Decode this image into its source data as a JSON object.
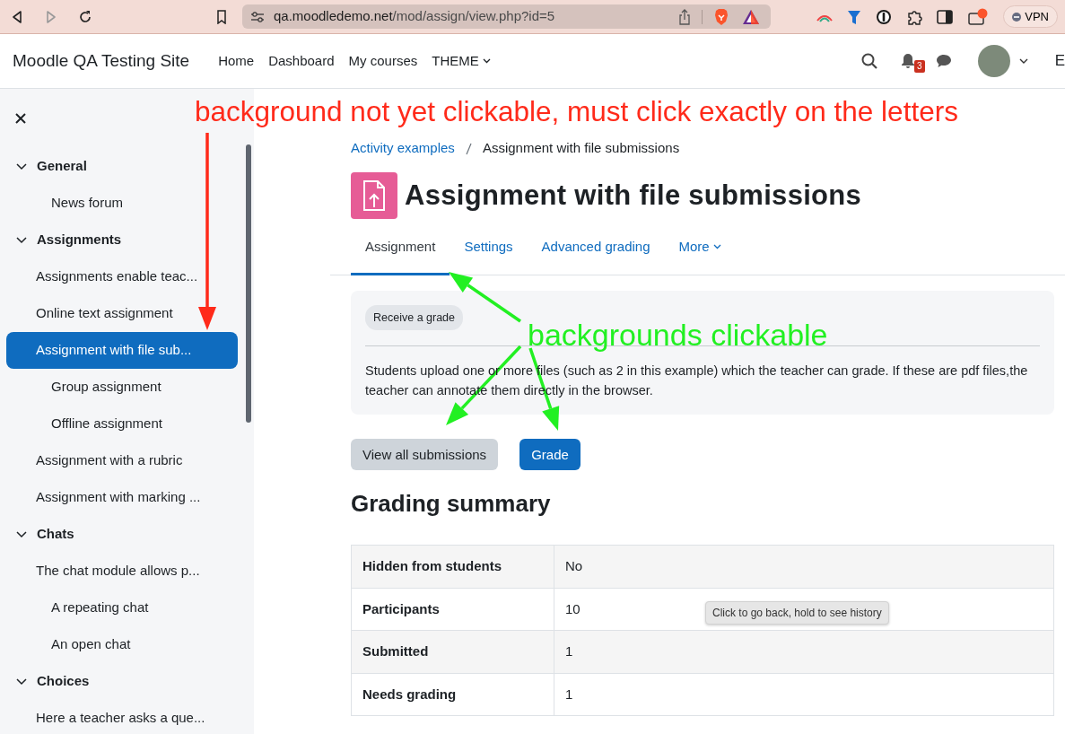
{
  "browser": {
    "url_host": "qa.moodledemo.net",
    "url_path": "/mod/assign/view.php?id=5",
    "vpn_label": "VPN"
  },
  "navbar": {
    "brand": "Moodle QA Testing Site",
    "links": [
      {
        "label": "Home",
        "dropdown": false
      },
      {
        "label": "Dashboard",
        "dropdown": false
      },
      {
        "label": "My courses",
        "dropdown": false
      },
      {
        "label": "THEME",
        "dropdown": true
      }
    ],
    "notification_count": "3",
    "user_menu_text": "E"
  },
  "sidebar": {
    "sections": [
      {
        "title": "General",
        "expanded": true,
        "items": [
          {
            "label": "News forum",
            "indented": true,
            "selected": false
          }
        ]
      },
      {
        "title": "Assignments",
        "expanded": true,
        "items": [
          {
            "label": "Assignments enable teac...",
            "indented": false,
            "selected": false
          },
          {
            "label": "Online text assignment",
            "indented": false,
            "selected": false
          },
          {
            "label": "Assignment with file sub...",
            "indented": false,
            "selected": true
          },
          {
            "label": "Group assignment",
            "indented": true,
            "selected": false
          },
          {
            "label": "Offline assignment",
            "indented": true,
            "selected": false
          },
          {
            "label": "Assignment with a rubric",
            "indented": false,
            "selected": false
          },
          {
            "label": "Assignment with marking ...",
            "indented": false,
            "selected": false
          }
        ]
      },
      {
        "title": "Chats",
        "expanded": true,
        "items": [
          {
            "label": "The chat module allows p...",
            "indented": false,
            "selected": false
          },
          {
            "label": "A repeating chat",
            "indented": true,
            "selected": false
          },
          {
            "label": "An open chat",
            "indented": true,
            "selected": false
          }
        ]
      },
      {
        "title": "Choices",
        "expanded": true,
        "items": [
          {
            "label": "Here a teacher asks a que...",
            "indented": false,
            "selected": false
          }
        ]
      }
    ]
  },
  "breadcrumb": [
    {
      "label": "Activity examples",
      "link": true
    },
    {
      "label": "Assignment with file submissions",
      "link": false
    }
  ],
  "page_title": "Assignment with file submissions",
  "tabs": [
    {
      "label": "Assignment",
      "selected": true,
      "dropdown": false
    },
    {
      "label": "Settings",
      "selected": false,
      "dropdown": false
    },
    {
      "label": "Advanced grading",
      "selected": false,
      "dropdown": false
    },
    {
      "label": "More",
      "selected": false,
      "dropdown": true
    }
  ],
  "activity_info": {
    "badge": "Receive a grade",
    "description": "Students upload one or more files (such as 2 in this example) which the teacher can grade. If these are pdf files,the teacher can annotate them directly in the browser."
  },
  "buttons": [
    {
      "label": "View all submissions",
      "kind": "secondary"
    },
    {
      "label": "Grade",
      "kind": "primary"
    }
  ],
  "grading_summary": {
    "title": "Grading summary",
    "rows": [
      {
        "label": "Hidden from students",
        "value": "No"
      },
      {
        "label": "Participants",
        "value": "10"
      },
      {
        "label": "Submitted",
        "value": "1"
      },
      {
        "label": "Needs grading",
        "value": "1"
      }
    ]
  },
  "tooltip": "Click to go back, hold to see history",
  "annotations": [
    {
      "text": "background not yet clickable, must click exactly on the letters",
      "color": "#ff2a1a"
    },
    {
      "text": "backgrounds clickable",
      "color": "#22f022"
    }
  ]
}
